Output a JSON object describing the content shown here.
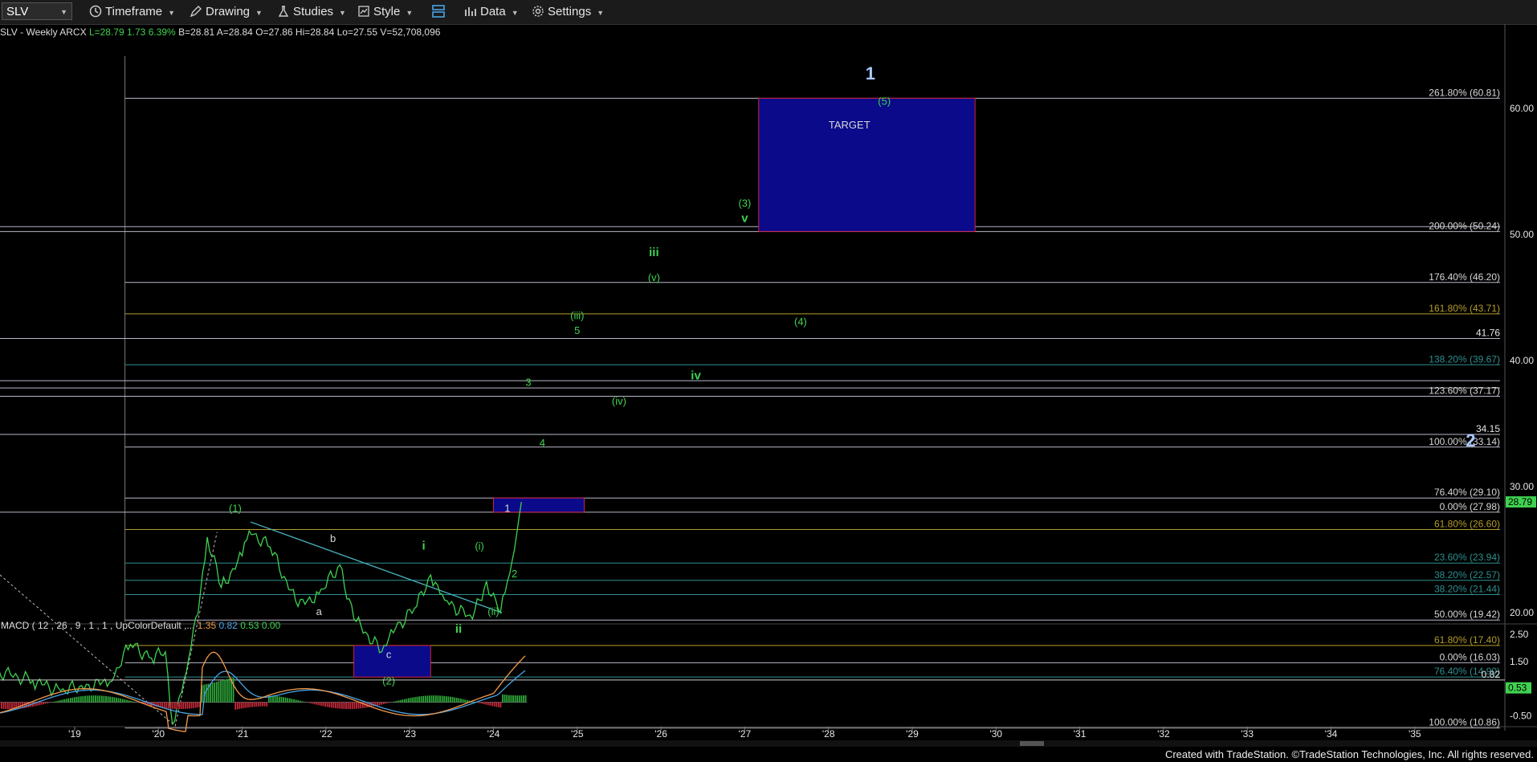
{
  "toolbar": {
    "symbol": "SLV",
    "items": [
      {
        "label": "Timeframe",
        "icon": "clock-icon"
      },
      {
        "label": "Drawing",
        "icon": "pencil-icon"
      },
      {
        "label": "Studies",
        "icon": "flask-icon"
      },
      {
        "label": "Style",
        "icon": "chart-style-icon"
      },
      {
        "label": "",
        "icon": "layout-icon"
      },
      {
        "label": "Data",
        "icon": "bars-icon"
      },
      {
        "label": "Settings",
        "icon": "gear-icon"
      }
    ]
  },
  "header": {
    "title": "SLV - Weekly  ARCX",
    "last": "L=28.79",
    "change": "1.73",
    "pct": "6.39%",
    "bid": "B=28.81",
    "ask": "A=28.84",
    "open": "O=27.86",
    "high": "Hi=28.84",
    "low": "Lo=27.55",
    "volume": "V=52,708,096"
  },
  "macd_label": {
    "text": "MACD ( 12 , 26 , 9 , 1 , 1 , UpColorDefault ,...",
    "v1": "1.35",
    "v2": "0.82",
    "v3": "0.53",
    "v4": "0.00"
  },
  "footer": "Created with TradeStation. ©TradeStation Technologies, Inc. All rights reserved.",
  "colors": {
    "bg": "#000000",
    "wave_green": "#3fd14f",
    "target_box": "#0a0a8a",
    "fib_line": "#b8b8c8",
    "axis_text": "#e6e6e6"
  },
  "chart_data": {
    "type": "line",
    "symbol": "SLV",
    "timeframe": "Weekly",
    "x_ticks": [
      "'19",
      "'20",
      "'21",
      "'22",
      "'23",
      "'24",
      "'25",
      "'26",
      "'27",
      "'28",
      "'29",
      "'30",
      "'31",
      "'32",
      "'33",
      "'34",
      "'35"
    ],
    "y_ticks": [
      20,
      30,
      40,
      50,
      60
    ],
    "ylim": [
      10,
      63
    ],
    "last_price": "28.79",
    "series": [
      {
        "name": "SLV",
        "points": [
          [
            "2018-01",
            15.5
          ],
          [
            "2018-07",
            14.6
          ],
          [
            "2018-11",
            13.8
          ],
          [
            "2019-03",
            14.3
          ],
          [
            "2019-06",
            14.5
          ],
          [
            "2019-09",
            17.5
          ],
          [
            "2019-12",
            16.4
          ],
          [
            "2020-02",
            16.9
          ],
          [
            "2020-03",
            11.2
          ],
          [
            "2020-05",
            15.3
          ],
          [
            "2020-07",
            21.5
          ],
          [
            "2020-08",
            26.0
          ],
          [
            "2020-10",
            22.0
          ],
          [
            "2021-01",
            24.5
          ],
          [
            "2021-02",
            26.5
          ],
          [
            "2021-05",
            25.2
          ],
          [
            "2021-09",
            20.5
          ],
          [
            "2021-12",
            21.5
          ],
          [
            "2022-03",
            23.8
          ],
          [
            "2022-05",
            19.5
          ],
          [
            "2022-09",
            16.9
          ],
          [
            "2022-11",
            18.8
          ],
          [
            "2023-02",
            20.5
          ],
          [
            "2023-04",
            23.0
          ],
          [
            "2023-06",
            21.0
          ],
          [
            "2023-10",
            19.5
          ],
          [
            "2023-12",
            22.5
          ],
          [
            "2024-02",
            20.0
          ],
          [
            "2024-03",
            22.5
          ],
          [
            "2024-04",
            25.0
          ],
          [
            "2024-05",
            28.79
          ]
        ]
      }
    ],
    "fib_levels": [
      {
        "label": "261.80% (60.81)",
        "value": 60.81
      },
      {
        "label": "50.63",
        "value": 50.63
      },
      {
        "label": "200.00% (50.24)",
        "value": 50.24
      },
      {
        "label": "176.40% (46.20)",
        "value": 46.2
      },
      {
        "label": "161.80% (43.71)",
        "value": 43.71
      },
      {
        "label": "41.76",
        "value": 41.76
      },
      {
        "label": "138.20% (39.67)",
        "value": 39.67
      },
      {
        "label": "38.41",
        "value": 38.41
      },
      {
        "label": "37.83",
        "value": 37.83
      },
      {
        "label": "123.60% (37.17)",
        "value": 37.17
      },
      {
        "label": "34.15",
        "value": 34.15
      },
      {
        "label": "100.00% (33.14)",
        "value": 33.14
      },
      {
        "label": "76.40% (29.10)",
        "value": 29.1
      },
      {
        "label": "0.00% (27.98)",
        "value": 27.98
      },
      {
        "label": "61.80% (26.60)",
        "value": 26.6
      },
      {
        "label": "23.60% (23.94)",
        "value": 23.94
      },
      {
        "label": "38.20% (22.57)",
        "value": 22.57
      },
      {
        "label": "38.20% (21.44)",
        "value": 21.44
      },
      {
        "label": "50.00% (19.42)",
        "value": 19.42
      },
      {
        "label": "61.80% (17.40)",
        "value": 17.4
      },
      {
        "label": "0.00% (16.03)",
        "value": 16.03
      },
      {
        "label": "76.40% (14.90)",
        "value": 14.9
      },
      {
        "label": "100.00% (10.86)",
        "value": 10.86
      }
    ],
    "wave_labels": [
      {
        "text": "1",
        "date": "2028-07",
        "value": 62.3
      },
      {
        "text": "(5)",
        "date": "2028-09",
        "value": 60.3
      },
      {
        "text": "TARGET",
        "date": "2028-04",
        "value": 58.4
      },
      {
        "text": "(3)",
        "date": "2027-01",
        "value": 52.2
      },
      {
        "text": "v",
        "date": "2027-01",
        "value": 51.0
      },
      {
        "text": "iii",
        "date": "2025-12",
        "value": 48.3
      },
      {
        "text": "(v)",
        "date": "2025-12",
        "value": 46.3
      },
      {
        "text": "(iii)",
        "date": "2025-01",
        "value": 43.3
      },
      {
        "text": "5",
        "date": "2025-01",
        "value": 42.1
      },
      {
        "text": "(4)",
        "date": "2027-09",
        "value": 42.8
      },
      {
        "text": "iv",
        "date": "2026-06",
        "value": 38.5
      },
      {
        "text": "3",
        "date": "2024-06",
        "value": 38.0
      },
      {
        "text": "(iv)",
        "date": "2025-07",
        "value": 36.5
      },
      {
        "text": "4",
        "date": "2024-08",
        "value": 33.2
      },
      {
        "text": "2",
        "date": "2035-09",
        "value": 33.2
      },
      {
        "text": "(1)",
        "date": "2020-12",
        "value": 28.0
      },
      {
        "text": "1",
        "date": "2024-03",
        "value": 28.0
      },
      {
        "text": "b",
        "date": "2022-02",
        "value": 25.6
      },
      {
        "text": "i",
        "date": "2023-03",
        "value": 25.0
      },
      {
        "text": "(i)",
        "date": "2023-11",
        "value": 25.0
      },
      {
        "text": "2",
        "date": "2024-04",
        "value": 22.8
      },
      {
        "text": "a",
        "date": "2021-12",
        "value": 19.8
      },
      {
        "text": "(ii)",
        "date": "2024-01",
        "value": 19.8
      },
      {
        "text": "ii",
        "date": "2023-08",
        "value": 18.4
      },
      {
        "text": "c",
        "date": "2022-10",
        "value": 16.4
      },
      {
        "text": "(2)",
        "date": "2022-10",
        "value": 14.3
      }
    ],
    "target_box": {
      "from": "2027-03",
      "to": "2029-10",
      "low": 50.24,
      "high": 60.81,
      "label": "TARGET"
    },
    "box_2": {
      "from": "2022-05",
      "to": "2023-04",
      "low": 14.9,
      "high": 17.4
    },
    "box_1": {
      "from": "2024-01",
      "to": "2025-02",
      "low": 27.98,
      "high": 29.1
    },
    "price_badge": "28.79",
    "price_axis_extra": [
      "41.76",
      "34.15"
    ],
    "macd": {
      "y_ticks": [
        "2.50",
        "1.50",
        "0.82",
        "-0.50"
      ],
      "last_macd": "0.53",
      "last_signal": "0.82",
      "ylim": [
        -0.9,
        2.8
      ]
    }
  }
}
